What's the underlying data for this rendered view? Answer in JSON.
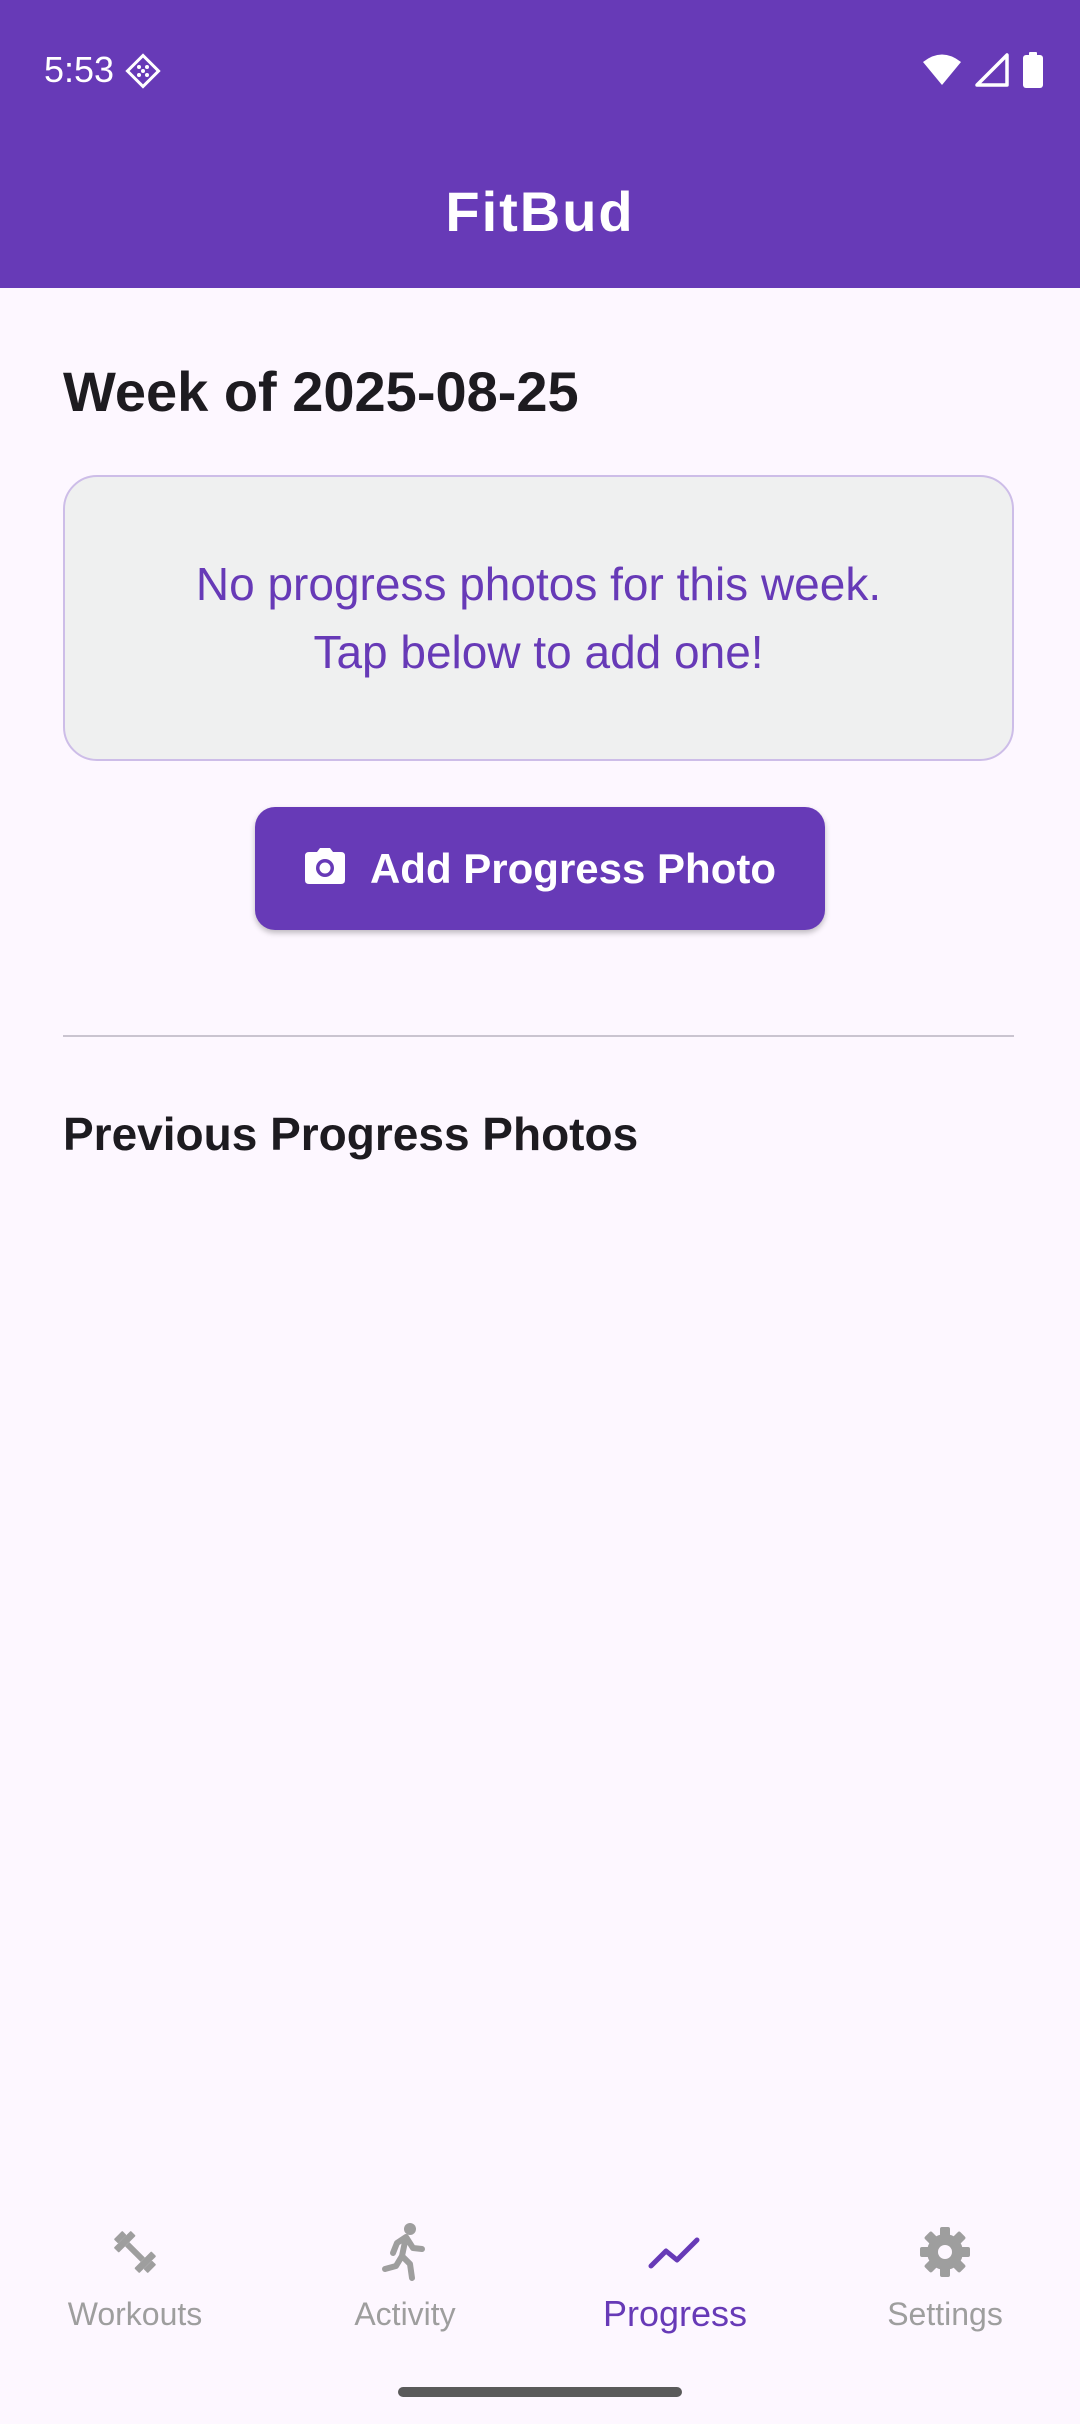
{
  "status_bar": {
    "time": "5:53",
    "app_icon": "diamond-grid-icon",
    "wifi_icon": "wifi-icon",
    "signal_icon": "cell-signal-icon",
    "battery_icon": "battery-icon"
  },
  "app_bar": {
    "title": "FitBud",
    "color": "#673ab7"
  },
  "main": {
    "week_title": "Week of 2025-08-25",
    "empty_state": {
      "line1": "No progress photos for this week.",
      "line2": "Tap below to add one!"
    },
    "add_button": {
      "label": "Add Progress Photo",
      "icon": "camera-icon"
    },
    "previous_title": "Previous Progress Photos"
  },
  "bottom_nav": {
    "items": [
      {
        "label": "Workouts",
        "icon": "dumbbell-icon",
        "active": false
      },
      {
        "label": "Activity",
        "icon": "running-icon",
        "active": false
      },
      {
        "label": "Progress",
        "icon": "trending-up-icon",
        "active": true
      },
      {
        "label": "Settings",
        "icon": "gear-icon",
        "active": false
      }
    ],
    "active_color": "#673ab7",
    "inactive_color": "#9e9e9e"
  }
}
